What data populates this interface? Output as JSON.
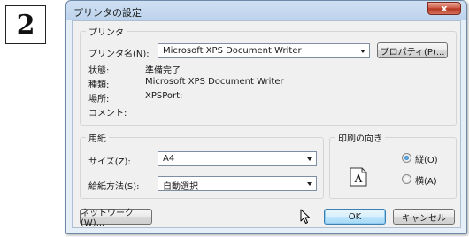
{
  "step_badge": "2",
  "dialog": {
    "title": "プリンタの設定",
    "close_label": "x"
  },
  "printer": {
    "legend": "プリンタ",
    "name_label": "プリンタ名(N):",
    "name_value": "Microsoft XPS Document Writer",
    "properties_button": "プロパティ(P)...",
    "status_label": "状態:",
    "status_value": "準備完了",
    "type_label": "種類:",
    "type_value": "Microsoft XPS Document Writer",
    "where_label": "場所:",
    "where_value": "XPSPort:",
    "comment_label": "コメント:",
    "comment_value": ""
  },
  "paper": {
    "legend": "用紙",
    "size_label": "サイズ(Z):",
    "size_value": "A4",
    "source_label": "給紙方法(S):",
    "source_value": "自動選択"
  },
  "orientation": {
    "legend": "印刷の向き",
    "icon_letter": "A",
    "portrait_label": "縦(O)",
    "landscape_label": "横(A)",
    "selected": "portrait"
  },
  "buttons": {
    "network": "ネットワーク(W)...",
    "ok": "OK",
    "cancel": "キャンセル"
  },
  "icons": {
    "combo_arrow": "chevron-down-icon",
    "cursor": "mouse-pointer-icon",
    "orientation": "portrait-page-icon"
  },
  "colors": {
    "title_bar": "#bcd3ec",
    "close_button": "#c9543e",
    "default_button": "#bee6fd",
    "radio_selected": "#1b6fb7"
  }
}
